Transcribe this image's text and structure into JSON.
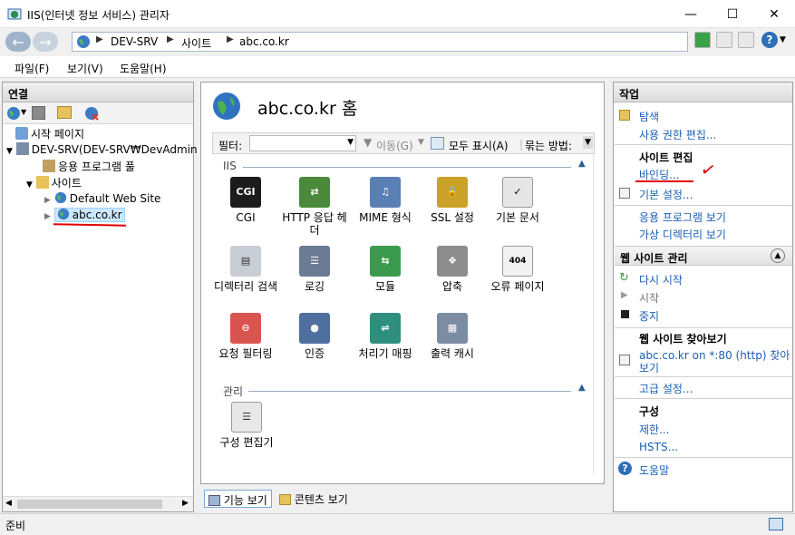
{
  "window": {
    "title": "IIS(인터넷 정보 서비스) 관리자",
    "controls": [
      "minimize",
      "maximize",
      "close"
    ]
  },
  "address": {
    "crumbs": [
      "DEV-SRV",
      "사이트",
      "abc.co.kr"
    ]
  },
  "menu": [
    "파일(F)",
    "보기(V)",
    "도움말(H)"
  ],
  "left": {
    "header": "연결",
    "tree": [
      {
        "label": "시작 페이지",
        "icon": "start-page-icon"
      },
      {
        "label": "DEV-SRV(DEV-SRV₩DevAdmin",
        "icon": "server-icon"
      },
      {
        "label": "응용 프로그램 풀",
        "icon": "app-pool-icon"
      },
      {
        "label": "사이트",
        "icon": "sites-folder-icon"
      },
      {
        "label": "Default Web Site",
        "icon": "globe-icon"
      },
      {
        "label": "abc.co.kr",
        "icon": "globe-icon",
        "selected": true
      }
    ]
  },
  "center": {
    "title": "abc.co.kr 홈",
    "filter": {
      "label": "필터:",
      "go": "이동(G)",
      "show_all": "모두 표시(A)",
      "group_by": "묶는 방법:"
    },
    "sections": [
      {
        "name": "IIS",
        "features": [
          {
            "label": "CGI",
            "icon": "cgi-icon"
          },
          {
            "label": "HTTP 응답 헤더",
            "icon": "http-headers-icon"
          },
          {
            "label": "MIME 형식",
            "icon": "mime-icon"
          },
          {
            "label": "SSL 설정",
            "icon": "ssl-lock-icon"
          },
          {
            "label": "기본 문서",
            "icon": "default-document-icon"
          },
          {
            "label": "디렉터리 검색",
            "icon": "directory-browse-icon"
          },
          {
            "label": "로깅",
            "icon": "logging-icon"
          },
          {
            "label": "모듈",
            "icon": "modules-icon"
          },
          {
            "label": "압축",
            "icon": "compression-icon"
          },
          {
            "label": "오류 페이지",
            "icon": "error-pages-icon"
          },
          {
            "label": "요청 필터링",
            "icon": "request-filter-icon"
          },
          {
            "label": "인증",
            "icon": "authentication-icon"
          },
          {
            "label": "처리기 매핑",
            "icon": "handler-mapping-icon"
          },
          {
            "label": "출력 캐시",
            "icon": "output-cache-icon"
          }
        ]
      },
      {
        "name": "관리",
        "features": [
          {
            "label": "구성 편집기",
            "icon": "config-editor-icon"
          }
        ]
      }
    ],
    "tabs": [
      "기능 보기",
      "콘텐츠 보기"
    ]
  },
  "right": {
    "header": "작업",
    "explore": "탐색",
    "edit_permissions": "사용 권한 편집...",
    "edit_site_head": "사이트 편집",
    "bindings": "바인딩...",
    "basic_settings": "기본 설정...",
    "view_apps": "응용 프로그램 보기",
    "view_vdirs": "가상 디렉터리 보기",
    "manage_head": "웹 사이트 관리",
    "restart": "다시 시작",
    "start": "시작",
    "stop": "중지",
    "browse_head": "웹 사이트 찾아보기",
    "browse_link_1": "abc.co.kr on *:80 (http) 찾아",
    "browse_link_2": "보기",
    "advanced": "고급 설정...",
    "config_head": "구성",
    "limits": "제한...",
    "hsts": "HSTS...",
    "help": "도움말"
  },
  "status": {
    "text": "준비"
  },
  "colors": {
    "accent": "#1a5fb4",
    "annotation_red": "#e00000"
  }
}
